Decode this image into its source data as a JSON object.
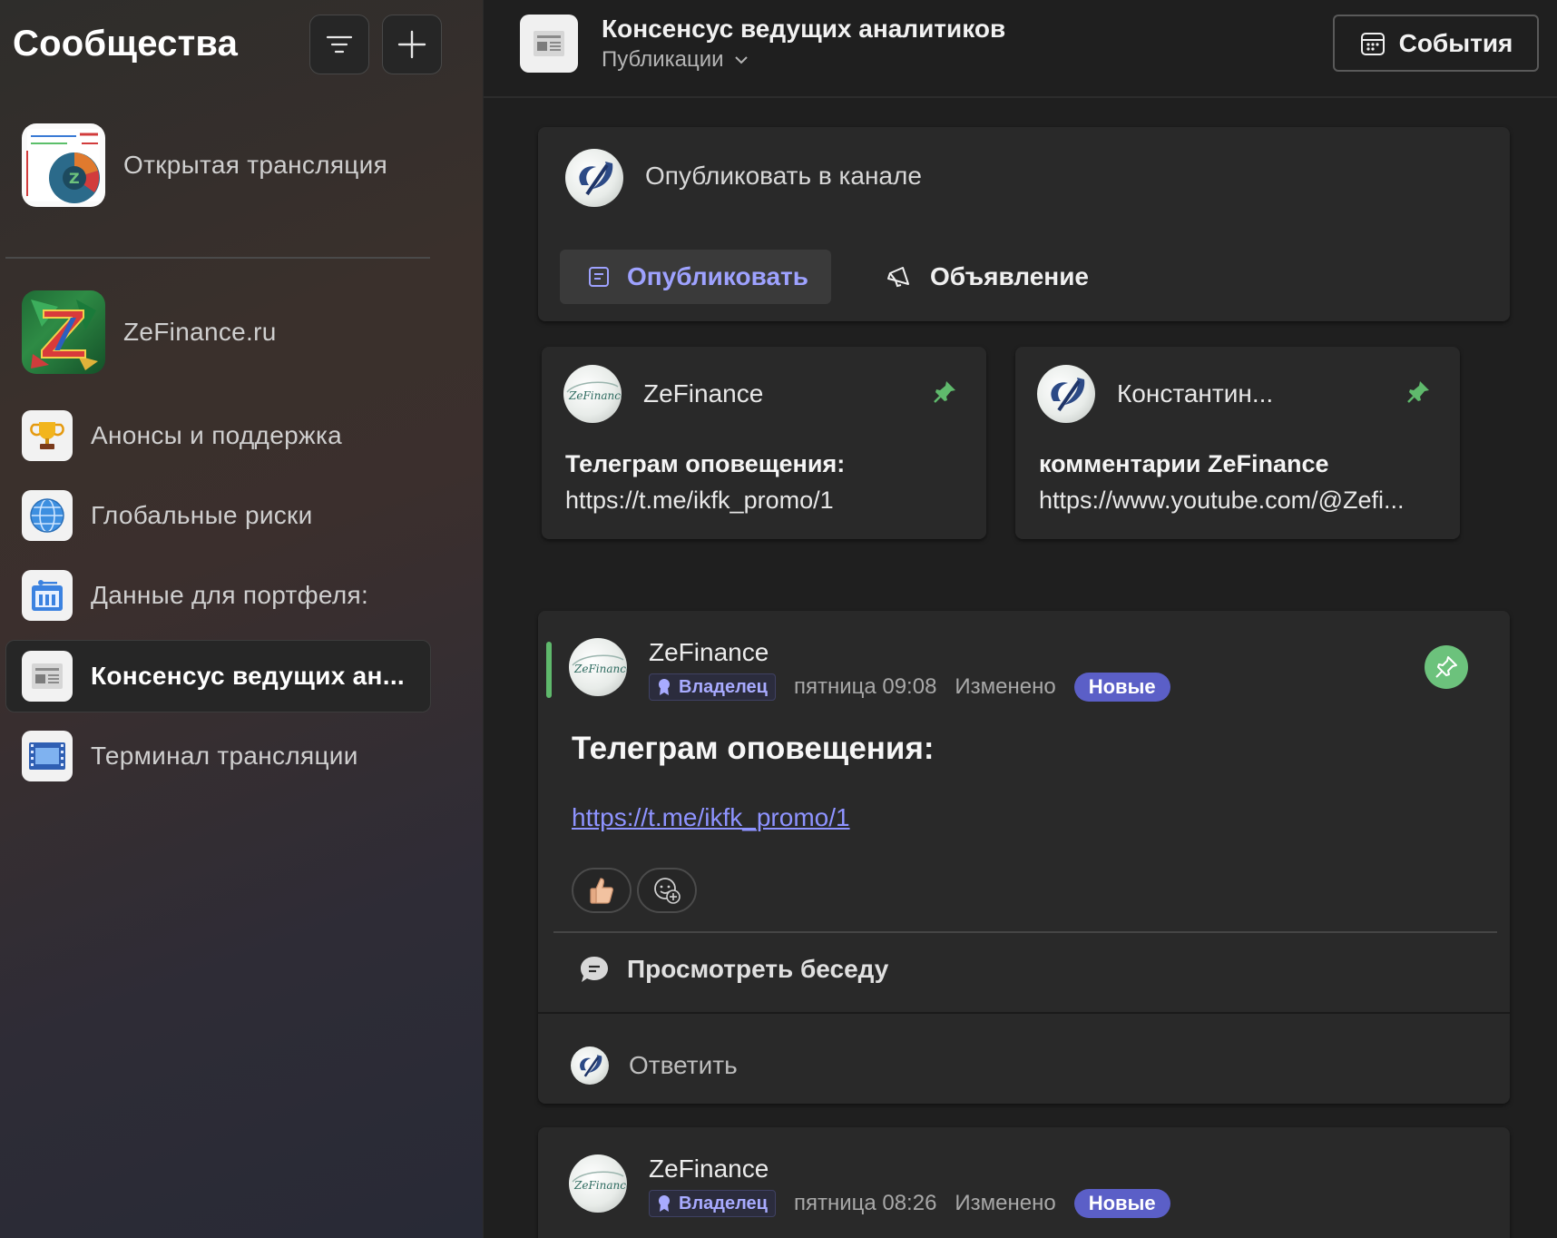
{
  "sidebar": {
    "title": "Сообщества",
    "filter_icon": "filter-lines-icon",
    "add_icon": "plus-icon",
    "open_broadcast": {
      "label": "Открытая трансляция",
      "icon": "chart-app-icon"
    },
    "team": {
      "label": "ZeFinance.ru",
      "icon": "zefinance-logo-icon"
    },
    "channels": [
      {
        "label": "Анонсы и поддержка",
        "icon": "trophy-icon"
      },
      {
        "label": "Глобальные риски",
        "icon": "globe-icon"
      },
      {
        "label": "Данные для портфеля:",
        "icon": "briefcase-icon"
      },
      {
        "label": "Консенсус ведущих ан...",
        "icon": "newspaper-icon",
        "active": true
      },
      {
        "label": "Терминал трансляции",
        "icon": "film-icon"
      }
    ]
  },
  "header": {
    "channel_name": "Консенсус ведущих аналитиков",
    "tab": "Публикации",
    "events_button": "События"
  },
  "compose": {
    "label": "Опубликовать в канале",
    "publish": "Опубликовать",
    "announcement": "Объявление"
  },
  "pinned": [
    {
      "author": "ZeFinance",
      "title": "Телеграм оповещения:",
      "text": "https://t.me/ikfk_promo/1"
    },
    {
      "author": "Константин...",
      "title": "комментарии ZeFinance",
      "text": "https://www.youtube.com/@Zefi..."
    }
  ],
  "posts": [
    {
      "author": "ZeFinance",
      "role": "Владелец",
      "time": "пятница 09:08",
      "edited": "Изменено",
      "badge": "Новые",
      "title": "Телеграм оповещения:",
      "link": "https://t.me/ikfk_promo/1",
      "reactions": [
        "thumbs-up-icon",
        "add-reaction-icon"
      ],
      "view_conversation": "Просмотреть беседу",
      "reply": "Ответить"
    },
    {
      "author": "ZeFinance",
      "role": "Владелец",
      "time": "пятница 08:26",
      "edited": "Изменено",
      "badge": "Новые"
    }
  ],
  "colors": {
    "accent": "#5b5fc7",
    "accent_text": "#9ea2ff",
    "pin_green": "#5fb96c",
    "background": "#1f1f1f",
    "card": "#292929"
  }
}
